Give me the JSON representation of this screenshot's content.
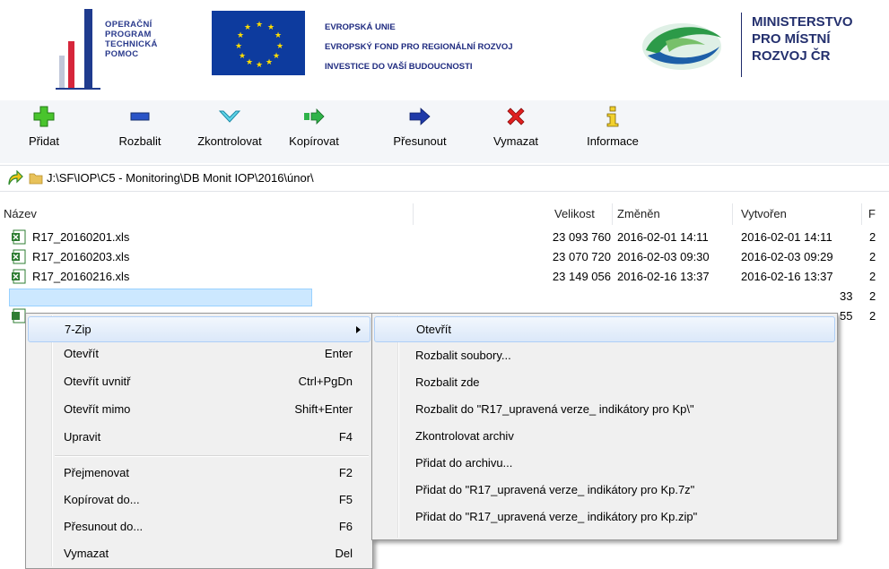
{
  "header": {
    "optp_lines": [
      "OPERAČNÍ",
      "PROGRAM",
      "TECHNICKÁ",
      "POMOC"
    ],
    "eu_lines": [
      "EVROPSKÁ UNIE",
      "EVROPSKÝ FOND PRO REGIONÁLNÍ ROZVOJ",
      "INVESTICE DO VAŠÍ BUDOUCNOSTI"
    ],
    "ministry_lines": [
      "MINISTERSTVO",
      "PRO MÍSTNÍ",
      "ROZVOJ ČR"
    ]
  },
  "toolbar": {
    "add": "Přidat",
    "extract": "Rozbalit",
    "test": "Zkontrolovat",
    "copy": "Kopírovat",
    "move": "Přesunout",
    "delete": "Vymazat",
    "info": "Informace"
  },
  "address": {
    "path": "J:\\SF\\IOP\\C5 - Monitoring\\DB Monit IOP\\2016\\únor\\"
  },
  "columns": {
    "name": "Název",
    "size": "Velikost",
    "modified": "Změněn",
    "created": "Vytvořen",
    "extra": "F"
  },
  "rows": [
    {
      "name": "R17_20160201.xls",
      "size": "23 093 760",
      "modified": "2016-02-01 14:11",
      "created": "2016-02-01 14:11",
      "extra": "2"
    },
    {
      "name": "R17_20160203.xls",
      "size": "23 070 720",
      "modified": "2016-02-03 09:30",
      "created": "2016-02-03 09:29",
      "extra": "2"
    },
    {
      "name": "R17_20160216.xls",
      "size": "23 149 056",
      "modified": "2016-02-16 13:37",
      "created": "2016-02-16 13:37",
      "extra": "2"
    }
  ],
  "partial_rows": [
    {
      "created_tail": "33",
      "extra": "2"
    },
    {
      "created_tail": "55",
      "extra": "2"
    }
  ],
  "context_menu": {
    "items": [
      {
        "label": "7-Zip",
        "shortcut": ""
      },
      {
        "label": "Otevřít",
        "shortcut": "Enter"
      },
      {
        "label": "Otevřít uvnitř",
        "shortcut": "Ctrl+PgDn"
      },
      {
        "label": "Otevřít mimo",
        "shortcut": "Shift+Enter"
      },
      {
        "label": "Upravit",
        "shortcut": "F4"
      },
      {
        "label": "Přejmenovat",
        "shortcut": "F2"
      },
      {
        "label": "Kopírovat do...",
        "shortcut": "F5"
      },
      {
        "label": "Přesunout do...",
        "shortcut": "F6"
      },
      {
        "label": "Vymazat",
        "shortcut": "Del"
      }
    ]
  },
  "submenu": {
    "items": [
      "Otevřít",
      "Rozbalit soubory...",
      "Rozbalit zde",
      "Rozbalit do \"R17_upravená verze_ indikátory pro Kp\\\"",
      "Zkontrolovat archiv",
      "Přidat do archivu...",
      "Přidat do \"R17_upravená verze_ indikátory pro Kp.7z\"",
      "Přidat do \"R17_upravená verze_ indikátory pro Kp.zip\""
    ]
  },
  "colors": {
    "toolbar_bg": "#f4f6f9",
    "menu_bg": "#f0f0f0",
    "highlight": "#dbe8f9",
    "selection": "#cce8ff"
  }
}
